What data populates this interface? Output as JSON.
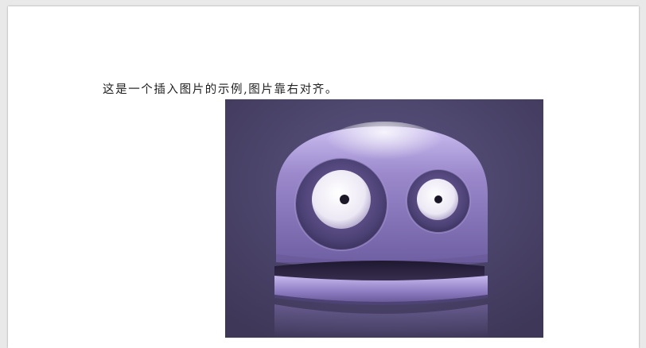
{
  "document": {
    "paragraph": "这是一个插入图片的示例,图片靠右对齐。"
  },
  "colors": {
    "page": "#ffffff",
    "workspace": "#e9e9e9",
    "image_background": "#4a4266",
    "robot_body": "#8b7ab8"
  },
  "image": {
    "subject": "purple-robot-head-icon"
  }
}
